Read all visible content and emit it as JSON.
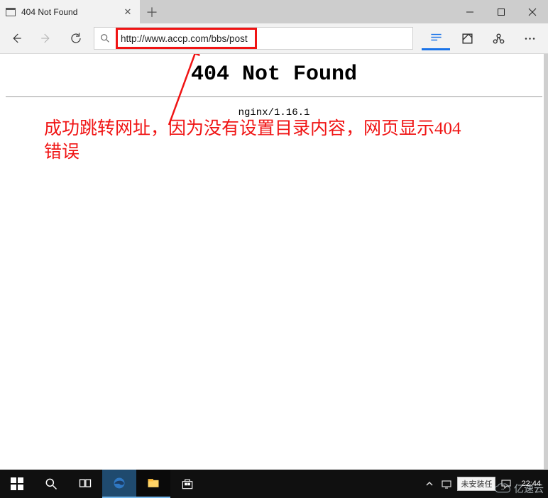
{
  "tab": {
    "title": "404 Not Found"
  },
  "toolbar": {
    "url": "http://www.accp.com/bbs/post"
  },
  "page": {
    "heading": "404 Not Found",
    "server": "nginx/1.16.1",
    "annotation": "成功跳转网址，因为没有设置目录内容，网页显示404错误"
  },
  "taskbar": {
    "ime_status": "未安装任",
    "clock": "22:44"
  },
  "watermark": {
    "text": "亿速云"
  }
}
